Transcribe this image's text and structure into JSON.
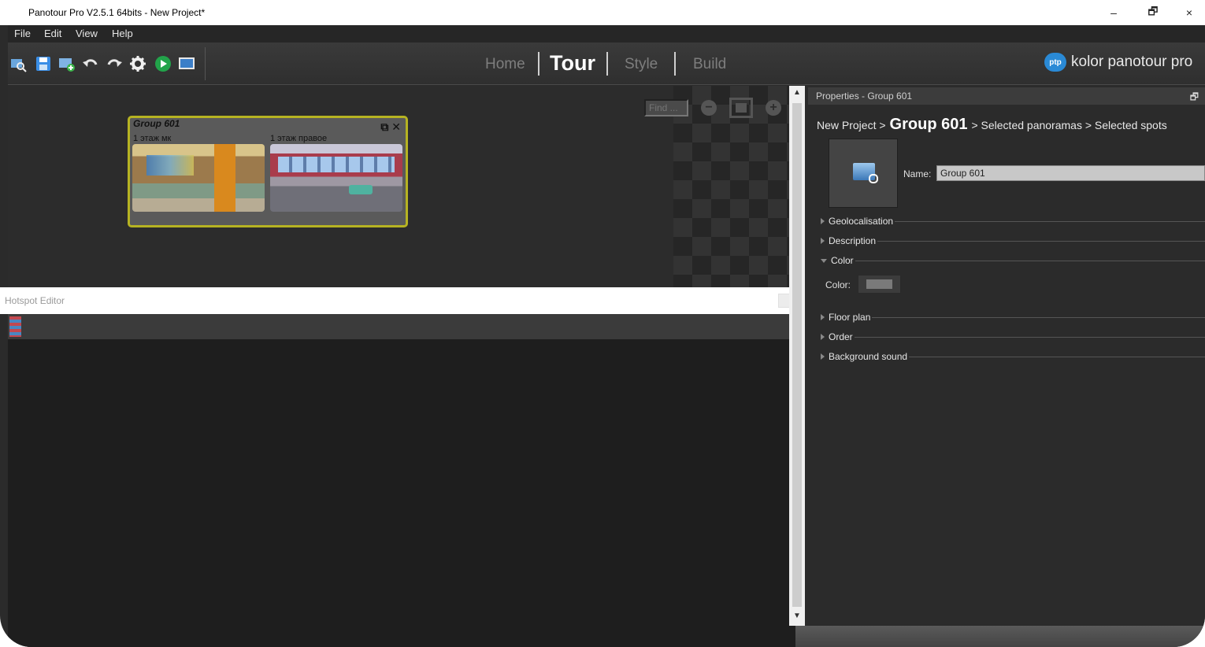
{
  "window": {
    "title": "Panotour Pro V2.5.1 64bits - New Project*",
    "minimize": "–",
    "restore": "🗗",
    "close": "×"
  },
  "menu": [
    "File",
    "Edit",
    "View",
    "Help"
  ],
  "toolbar": {
    "icons": [
      "open-project-icon",
      "save-icon",
      "add-panorama-icon",
      "undo-icon",
      "redo-icon",
      "settings-icon",
      "play-icon",
      "preview-icon"
    ]
  },
  "nav": {
    "home": "Home",
    "tour": "Tour",
    "style": "Style",
    "build": "Build"
  },
  "brand": {
    "logo": "ptp",
    "text": "kolor panotour pro"
  },
  "canvas": {
    "find_placeholder": "Find ...",
    "zoom_out": "−",
    "zoom_in": "+",
    "group": {
      "title": "Group 601",
      "detach": "⧉",
      "close": "✕",
      "panoramas": [
        "1 этаж мк",
        "1 этаж правое"
      ]
    }
  },
  "hotspot_editor": {
    "title": "Hotspot Editor"
  },
  "properties": {
    "header": "Properties - Group 601",
    "pin": "🗗",
    "breadcrumb": {
      "root": "New Project >",
      "current": "Group 601",
      "rest": "> Selected panoramas > Selected spots"
    },
    "name_label": "Name:",
    "name_value": "Group 601",
    "sections": {
      "geo": "Geolocalisation",
      "description": "Description",
      "color": "Color",
      "floor": "Floor plan",
      "order": "Order",
      "sound": "Background sound"
    },
    "color_label": "Color:",
    "color_value": "#7a7a7a"
  }
}
